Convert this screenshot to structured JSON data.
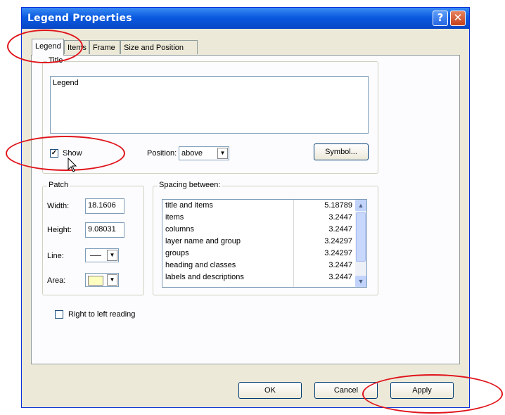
{
  "window": {
    "title": "Legend Properties",
    "help_label": "?",
    "close_label": "✕"
  },
  "tabs": [
    {
      "label": "Legend",
      "active": true
    },
    {
      "label": "Items"
    },
    {
      "label": "Frame"
    },
    {
      "label": "Size and Position"
    }
  ],
  "title_group": {
    "label": "Title",
    "value": "Legend",
    "show_label": "Show",
    "show_checked": "✓",
    "position_label": "Position:",
    "position_value": "above",
    "symbol_button": "Symbol..."
  },
  "patch_group": {
    "label": "Patch",
    "width_label": "Width:",
    "width_value": "18.1606",
    "height_label": "Height:",
    "height_value": "9.08031",
    "line_label": "Line:",
    "area_label": "Area:",
    "area_color": "#ffffc0"
  },
  "spacing_group": {
    "label": "Spacing between:",
    "rows": [
      {
        "name": "title and items",
        "value": "5.18789"
      },
      {
        "name": "items",
        "value": "3.2447"
      },
      {
        "name": "columns",
        "value": "3.2447"
      },
      {
        "name": "layer name and group",
        "value": "3.24297"
      },
      {
        "name": "groups",
        "value": "3.24297"
      },
      {
        "name": "heading and classes",
        "value": "3.2447"
      },
      {
        "name": "labels and descriptions",
        "value": "3.2447"
      }
    ]
  },
  "rtl": {
    "label": "Right to left reading",
    "checked": ""
  },
  "buttons": {
    "ok": "OK",
    "cancel": "Cancel",
    "apply": "Apply"
  },
  "colors": {
    "titlebar": "#0a5ae0",
    "annotation": "#e0141b"
  }
}
